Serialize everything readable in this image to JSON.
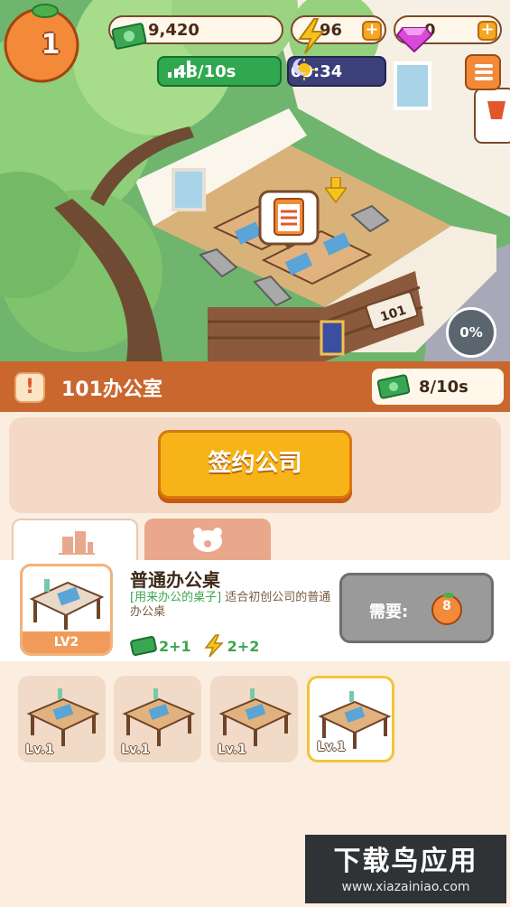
{
  "hud": {
    "level": "1",
    "money": "9,420",
    "energy": "96",
    "gems": "0",
    "rate": "48/10s",
    "time": "09:34"
  },
  "scene": {
    "door_number": "101",
    "progress": "0%"
  },
  "room": {
    "title": "101办公室",
    "income": "8/10s"
  },
  "sign_button": "签约公司",
  "item": {
    "name": "普通办公桌",
    "desc_highlight": "[用来办公的桌子]",
    "desc_rest": "适合初创公司的普通办公桌",
    "level": "LV2",
    "stat_money": "2+1",
    "stat_energy": "2+2",
    "need_label": "需要:",
    "need_cost": "8"
  },
  "inventory": [
    {
      "level": "Lv.1",
      "selected": false
    },
    {
      "level": "Lv.1",
      "selected": false
    },
    {
      "level": "Lv.1",
      "selected": false
    },
    {
      "level": "Lv.1",
      "selected": true
    }
  ],
  "watermark": {
    "title": "下载鸟应用",
    "url": "www.xiazainiao.com"
  },
  "colors": {
    "accent_orange": "#f28a3a",
    "sign_yellow": "#f7b418",
    "money_green": "#2fa84f",
    "room_bar": "#c9672e"
  },
  "icons": [
    "orange-icon",
    "money-icon",
    "lightning-icon",
    "gem-icon",
    "plus-icon",
    "chart-icon",
    "sun-moon-icon",
    "menu-icon",
    "cart-icon",
    "clipboard-icon",
    "arrow-down-icon",
    "alert-icon",
    "building-icon",
    "bear-icon",
    "desk-icon"
  ]
}
